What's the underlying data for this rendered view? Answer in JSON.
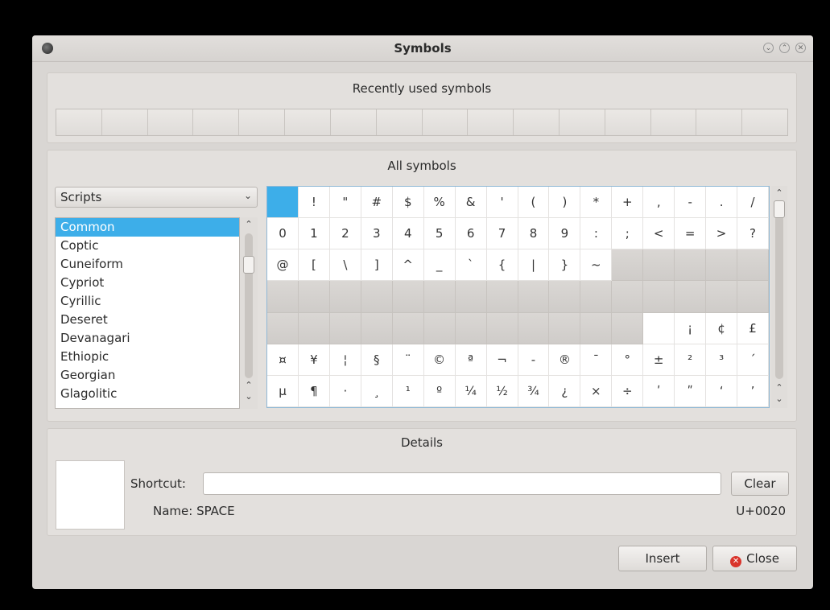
{
  "window": {
    "title": "Symbols"
  },
  "recent": {
    "title": "Recently used symbols",
    "slots": [
      "",
      "",
      "",
      "",
      "",
      "",
      "",
      "",
      "",
      "",
      "",
      "",
      "",
      "",
      "",
      ""
    ]
  },
  "all": {
    "title": "All symbols",
    "category": "Scripts",
    "scripts": [
      "Common",
      "Coptic",
      "Cuneiform",
      "Cypriot",
      "Cyrillic",
      "Deseret",
      "Devanagari",
      "Ethiopic",
      "Georgian",
      "Glagolitic"
    ],
    "selected_index": 0,
    "symbols": [
      [
        " ",
        "!",
        "\"",
        "#",
        "$",
        "%",
        "&",
        "'",
        "(",
        ")",
        "*",
        "+",
        ",",
        "-",
        ".",
        "/"
      ],
      [
        "0",
        "1",
        "2",
        "3",
        "4",
        "5",
        "6",
        "7",
        "8",
        "9",
        ":",
        ";",
        "<",
        "=",
        ">",
        "?"
      ],
      [
        "@",
        "[",
        "\\",
        "]",
        "^",
        "_",
        "`",
        "{",
        "|",
        "}",
        "~",
        null,
        null,
        null,
        null,
        null
      ],
      [
        null,
        null,
        null,
        null,
        null,
        null,
        null,
        null,
        null,
        null,
        null,
        null,
        null,
        null,
        null,
        null
      ],
      [
        null,
        null,
        null,
        null,
        null,
        null,
        null,
        null,
        null,
        null,
        null,
        null,
        "",
        "¡",
        "¢",
        "£"
      ],
      [
        "¤",
        "¥",
        "¦",
        "§",
        "¨",
        "©",
        "ª",
        "¬",
        "-",
        "®",
        "¯",
        "°",
        "±",
        "²",
        "³",
        "´"
      ],
      [
        "µ",
        "¶",
        "·",
        "¸",
        "¹",
        "º",
        "¼",
        "½",
        "¾",
        "¿",
        "×",
        "÷",
        "ʹ",
        "ʺ",
        "ʻ",
        "ʼ"
      ]
    ]
  },
  "details": {
    "title": "Details",
    "shortcut_label": "Shortcut:",
    "shortcut_value": "",
    "clear_label": "Clear",
    "name_label": "Name: SPACE",
    "codepoint": "U+0020"
  },
  "buttons": {
    "insert": "Insert",
    "close": "Close"
  },
  "colors": {
    "selection": "#3daee9",
    "close_icon": "#d9342b",
    "grid_border": "#8fb8d6"
  }
}
